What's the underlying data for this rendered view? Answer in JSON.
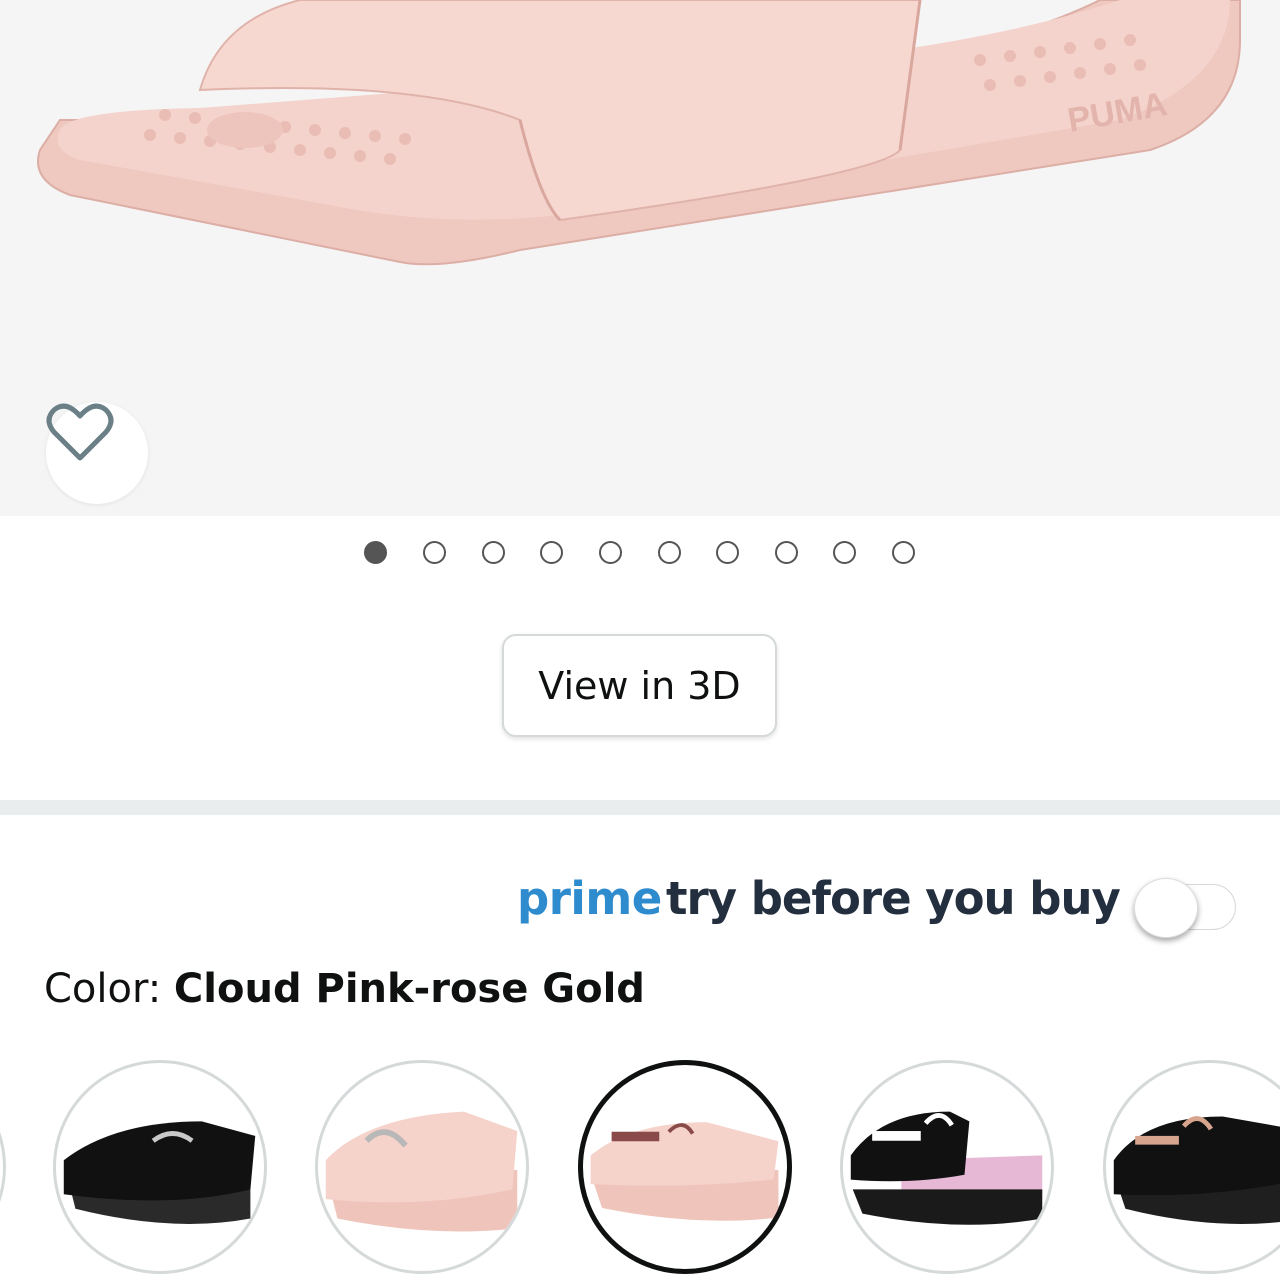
{
  "product": {
    "brand_mark": "PUMA",
    "image_index": 0,
    "image_count": 10,
    "accent_colors": {
      "sandal_pink": "#f2cfc8",
      "prime_blue": "#2e8bce",
      "text_dark": "#232f3e"
    }
  },
  "actions": {
    "wishlist_icon": "heart-outline-icon",
    "view_3d_label": "View in 3D"
  },
  "prime": {
    "brand": "prime",
    "label": "try before you buy",
    "toggle_on": false
  },
  "color": {
    "label": "Color: ",
    "selected": "Cloud Pink-rose Gold"
  },
  "swatches": [
    {
      "id": "black-silver",
      "primary": "#1a1a1a",
      "logo": "#c9c9c9",
      "selected": false
    },
    {
      "id": "pink-silver",
      "primary": "#f2cfc8",
      "logo": "#b8b8b8",
      "selected": false
    },
    {
      "id": "cloud-pink-rose-gold",
      "primary": "#f2cfc8",
      "logo": "#8a4a4a",
      "selected": true
    },
    {
      "id": "black-pink",
      "primary": "#1a1a1a",
      "logo": "#ffffff",
      "accent": "#e7b8d6",
      "selected": false
    },
    {
      "id": "black-rose-gold",
      "primary": "#1a1a1a",
      "logo": "#d7a58e",
      "selected": false
    }
  ]
}
